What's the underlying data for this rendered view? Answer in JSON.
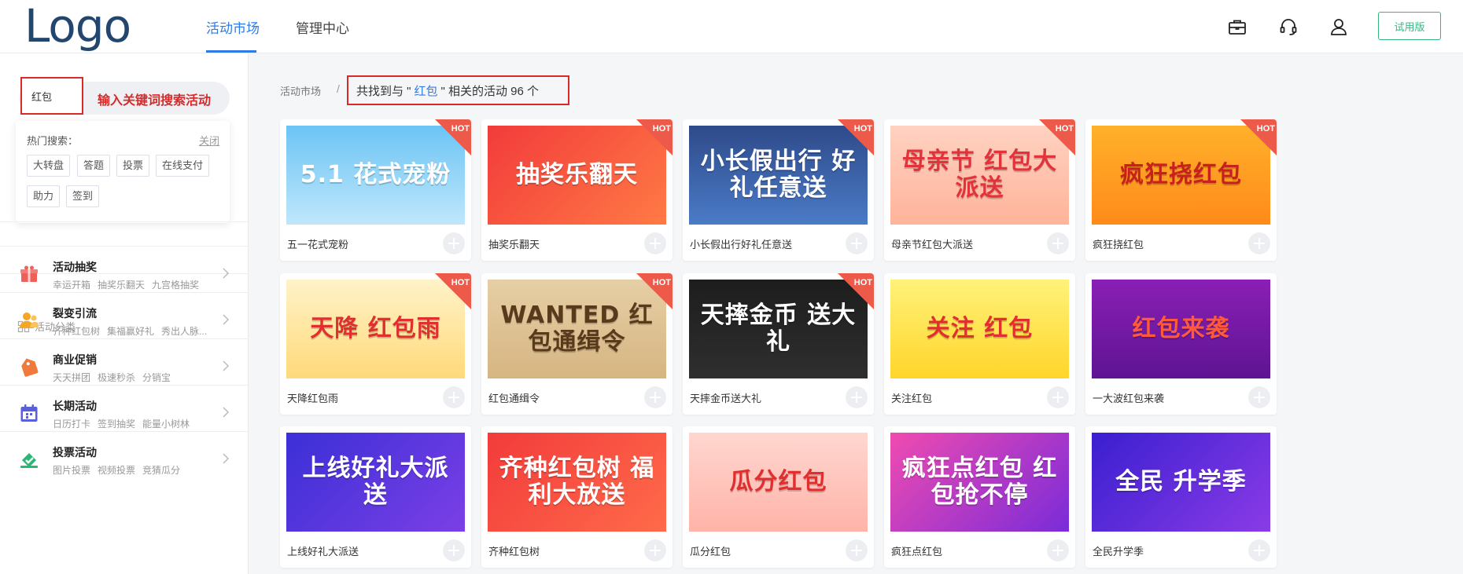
{
  "header": {
    "logo": "Logo",
    "nav": [
      "活动市场",
      "管理中心"
    ],
    "trial_button": "试用版",
    "icons": [
      "briefcase-icon",
      "headset-icon",
      "user-icon"
    ],
    "accent": "#2f7be6"
  },
  "sidebar": {
    "search_value": "红包",
    "search_hint": "输入关键词搜索活动",
    "hot_title": "热门搜索：",
    "hot_close": "关闭",
    "hot_tags": [
      "大转盘",
      "答题",
      "投票",
      "在线支付",
      "助力",
      "签到"
    ],
    "category_heading": "活动分类",
    "categories": [
      {
        "title": "活动抽奖",
        "subs": [
          "幸运开箱",
          "抽奖乐翻天",
          "九宫格抽奖"
        ],
        "icon": "gift-icon",
        "color": "#f0605a"
      },
      {
        "title": "裂变引流",
        "subs": [
          "齐种红包树",
          "集福赢好礼",
          "秀出人脉..."
        ],
        "icon": "people-icon",
        "color": "#f5a623"
      },
      {
        "title": "商业促销",
        "subs": [
          "天天拼团",
          "极速秒杀",
          "分销宝"
        ],
        "icon": "price-tag-icon",
        "color": "#f07a3c"
      },
      {
        "title": "长期活动",
        "subs": [
          "日历打卡",
          "签到抽奖",
          "能量小树林"
        ],
        "icon": "calendar-icon",
        "color": "#5b5fd9"
      },
      {
        "title": "投票活动",
        "subs": [
          "图片投票",
          "视频投票",
          "竞猜瓜分"
        ],
        "icon": "vote-check-icon",
        "color": "#2bb673"
      }
    ]
  },
  "main": {
    "breadcrumb_root": "活动市场",
    "breadcrumb_sep": "/",
    "result_prefix": "共找到与 \"",
    "result_keyword": "红包",
    "result_suffix": "\" 相关的活动 96 个",
    "hot_label": "HOT",
    "cards": [
      {
        "name": "五一花式宠粉",
        "banner": "5.1 花式宠粉",
        "bg": "linear-gradient(180deg,#6cc4f5,#bfe7fb)",
        "fg": "#ffffff",
        "hot": true
      },
      {
        "name": "抽奖乐翻天",
        "banner": "抽奖乐翻天",
        "bg": "linear-gradient(135deg,#f23b3b,#ff7a45)",
        "fg": "#ffffff",
        "hot": true
      },
      {
        "name": "小长假出行好礼任意送",
        "banner": "小长假出行 好礼任意送",
        "bg": "linear-gradient(180deg,#2e4a8a,#4b7bc7)",
        "fg": "#ffffff",
        "hot": true
      },
      {
        "name": "母亲节红包大派送",
        "banner": "母亲节 红包大派送",
        "bg": "linear-gradient(180deg,#ffd2c2,#ffb39a)",
        "fg": "#e2323a",
        "hot": true
      },
      {
        "name": "疯狂挠红包",
        "banner": "疯狂挠红包",
        "bg": "linear-gradient(180deg,#ffb12a,#ff8a1a)",
        "fg": "#c8201d",
        "hot": true
      },
      {
        "name": "天降红包雨",
        "banner": "天降 红包雨",
        "bg": "linear-gradient(180deg,#fff3c8,#ffd97a)",
        "fg": "#e12f2f",
        "hot": true
      },
      {
        "name": "红包通缉令",
        "banner": "WANTED 红包通缉令",
        "bg": "linear-gradient(180deg,#e6cfa5,#d6b582)",
        "fg": "#5a3a1c",
        "hot": true
      },
      {
        "name": "天摔金币送大礼",
        "banner": "天摔金币 送大礼",
        "bg": "linear-gradient(180deg,#1d1d1d,#2f2f2f)",
        "fg": "#ffffff",
        "hot": true
      },
      {
        "name": "关注红包",
        "banner": "关注 红包",
        "bg": "linear-gradient(180deg,#fff27a,#ffd52a)",
        "fg": "#e12f2f",
        "hot": false
      },
      {
        "name": "一大波红包来袭",
        "banner": "红包来袭",
        "bg": "linear-gradient(180deg,#8a1fb5,#5e1493)",
        "fg": "#ff5a3a",
        "hot": false
      },
      {
        "name": "上线好礼大派送",
        "banner": "上线好礼大派送",
        "bg": "linear-gradient(135deg,#3b2fd6,#7b3fe6)",
        "fg": "#ffffff",
        "hot": false
      },
      {
        "name": "齐种红包树",
        "banner": "齐种红包树 福利大放送",
        "bg": "linear-gradient(135deg,#f23b3b,#ff6b4a)",
        "fg": "#ffffff",
        "hot": false
      },
      {
        "name": "瓜分红包",
        "banner": "瓜分红包",
        "bg": "linear-gradient(180deg,#ffd7d0,#ffb3a8)",
        "fg": "#e12f2f",
        "hot": false
      },
      {
        "name": "疯狂点红包",
        "banner": "疯狂点红包 红包抢不停",
        "bg": "linear-gradient(135deg,#f04bb0,#7a2bd9)",
        "fg": "#ffffff",
        "hot": false
      },
      {
        "name": "全民升学季",
        "banner": "全民 升学季",
        "bg": "linear-gradient(135deg,#3a1fd0,#8a3be6)",
        "fg": "#ffffff",
        "hot": false
      }
    ]
  }
}
